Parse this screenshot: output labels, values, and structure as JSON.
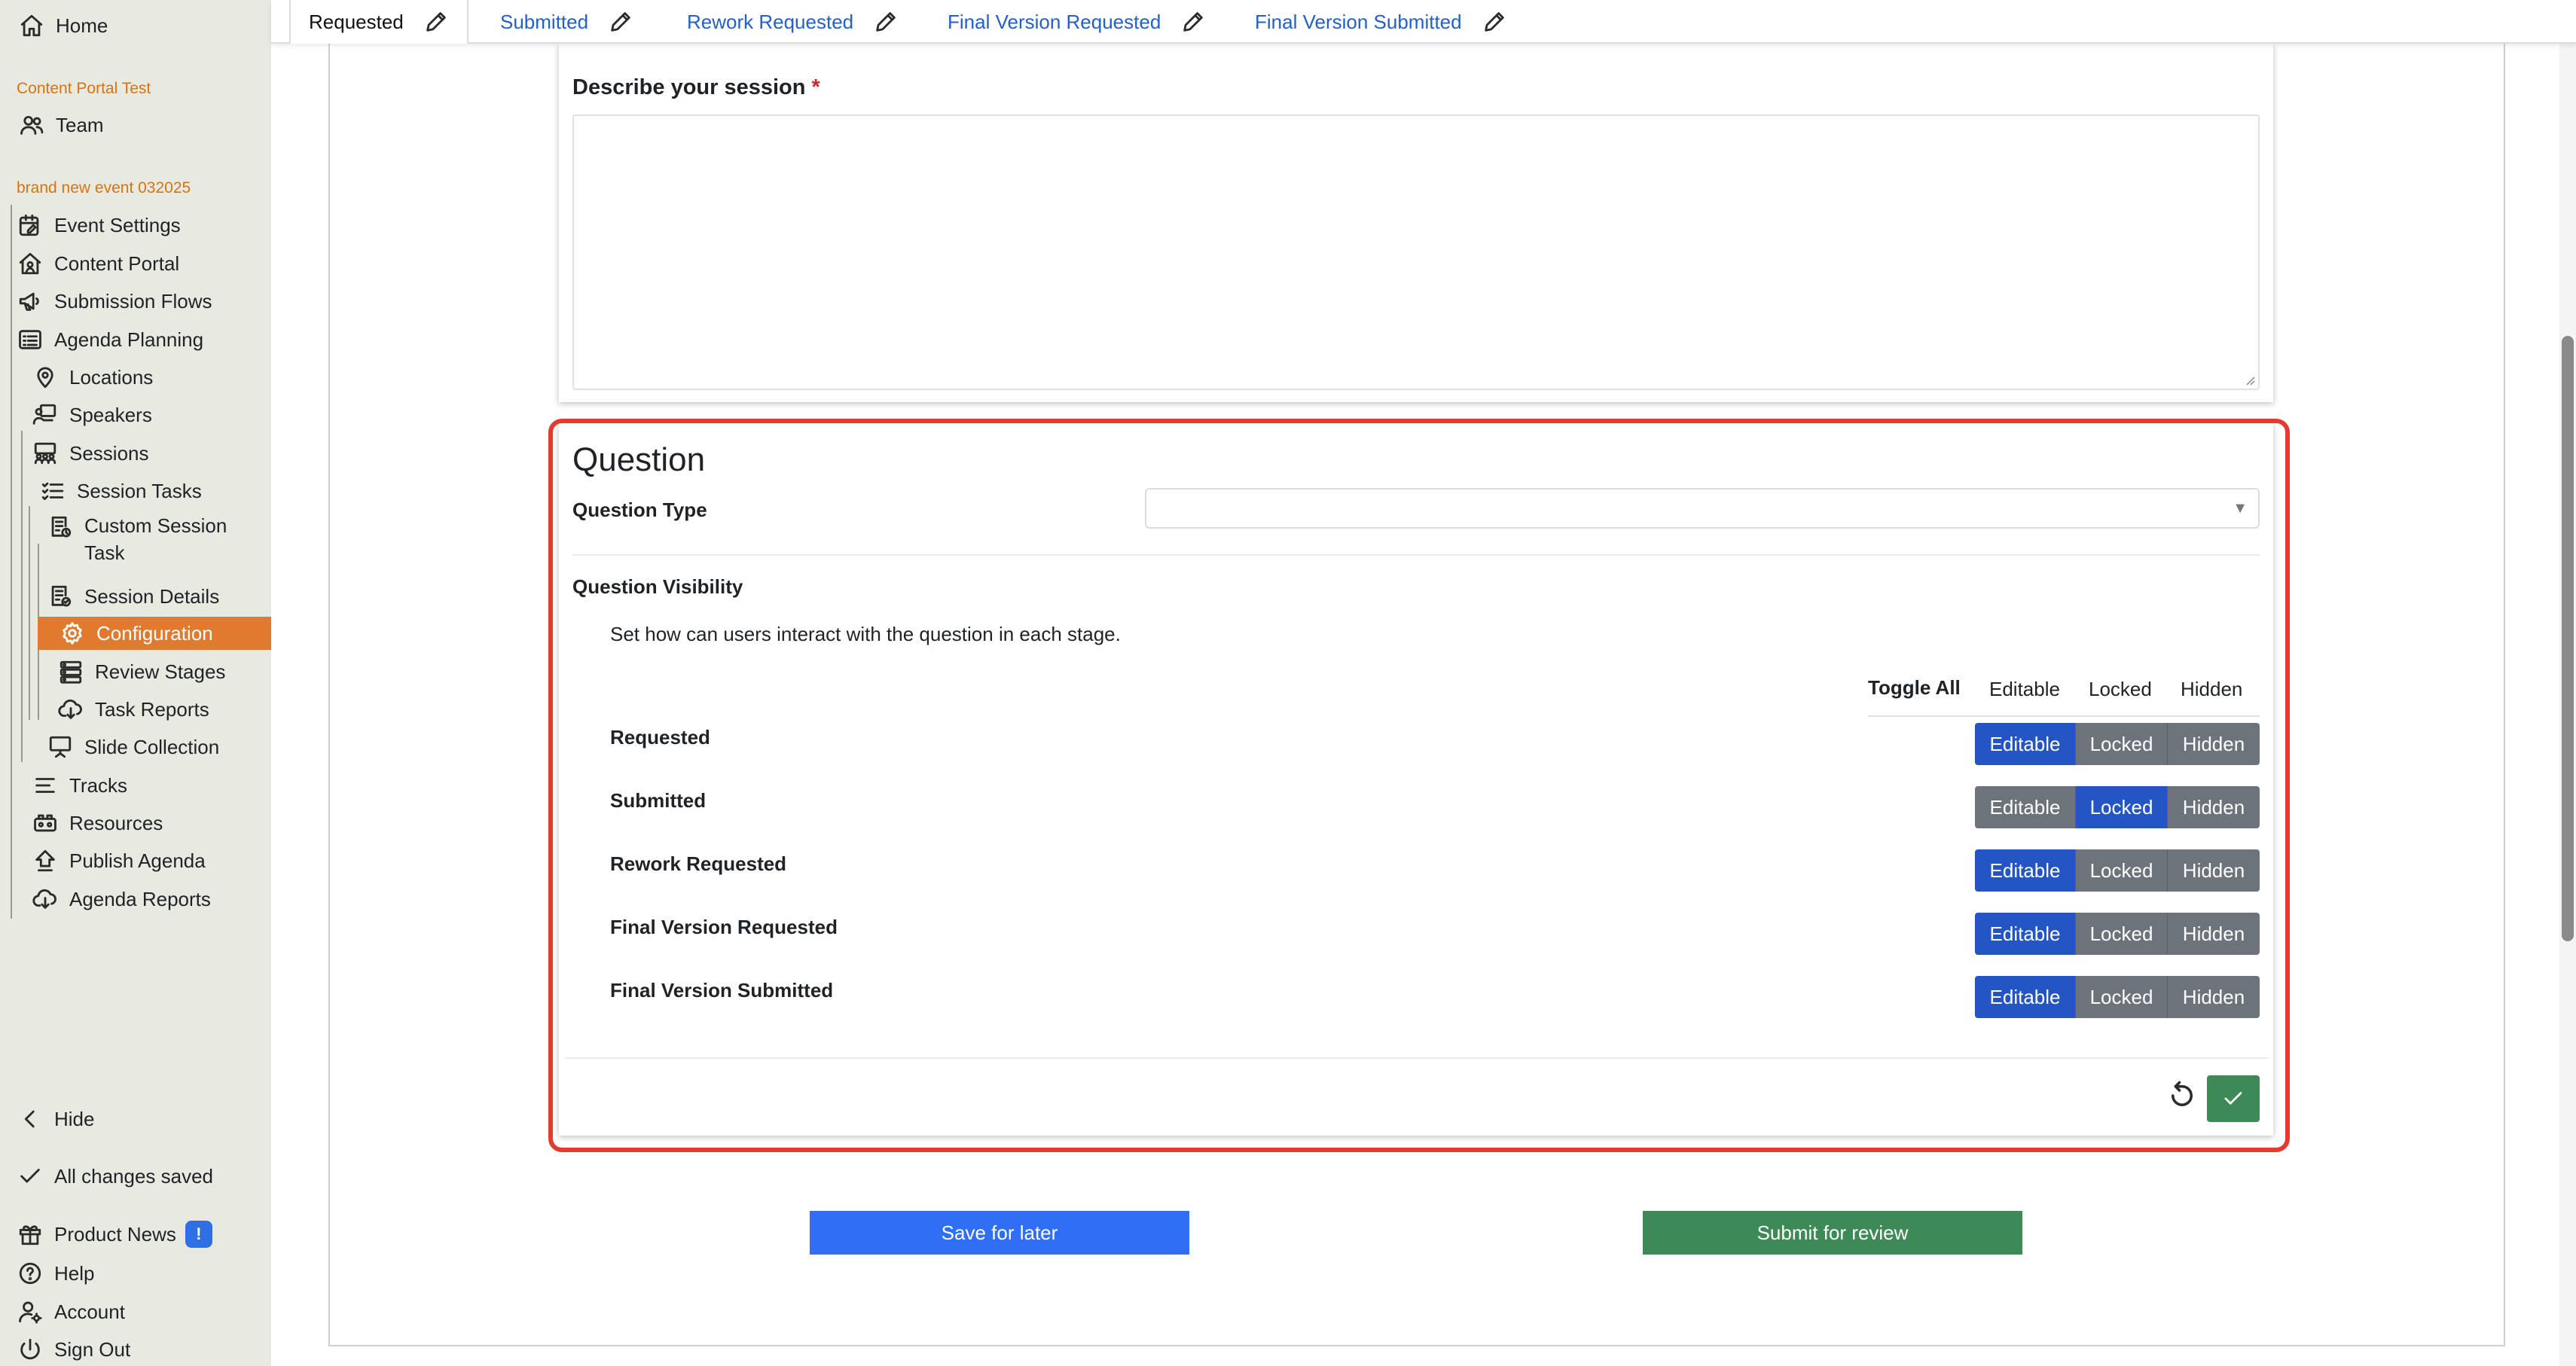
{
  "sidebar": {
    "home": "Home",
    "section_org": "Content Portal Test",
    "team": "Team",
    "section_event": "brand new event 032025",
    "event_settings": "Event Settings",
    "content_portal": "Content Portal",
    "submission_flows": "Submission Flows",
    "agenda_planning": "Agenda Planning",
    "locations": "Locations",
    "speakers": "Speakers",
    "sessions": "Sessions",
    "session_tasks": "Session Tasks",
    "custom_session_task_1": "Custom Session",
    "custom_session_task_2": "Task",
    "session_details": "Session Details",
    "configuration": "Configuration",
    "review_stages": "Review Stages",
    "task_reports": "Task Reports",
    "slide_collection": "Slide Collection",
    "tracks": "Tracks",
    "resources": "Resources",
    "publish_agenda": "Publish Agenda",
    "agenda_reports": "Agenda Reports",
    "hide": "Hide",
    "changes_saved": "All changes saved",
    "product_news": "Product News",
    "product_news_badge": "!",
    "help": "Help",
    "account": "Account",
    "sign_out": "Sign Out",
    "active_color": "#e07a2e"
  },
  "tabs": [
    {
      "label": "Requested",
      "active": true
    },
    {
      "label": "Submitted",
      "active": false
    },
    {
      "label": "Rework Requested",
      "active": false
    },
    {
      "label": "Final Version Requested",
      "active": false
    },
    {
      "label": "Final Version Submitted",
      "active": false
    }
  ],
  "describe": {
    "label": "Describe your session",
    "required_mark": "*",
    "value": ""
  },
  "question": {
    "title": "Question",
    "type_label": "Question Type",
    "type_value": "",
    "visibility_label": "Question Visibility",
    "helper": "Set how can users interact with the question in each stage.",
    "toggle_all": "Toggle All",
    "col_editable": "Editable",
    "col_locked": "Locked",
    "col_hidden": "Hidden",
    "stages": [
      {
        "label": "Requested",
        "selected": "Editable"
      },
      {
        "label": "Submitted",
        "selected": "Locked"
      },
      {
        "label": "Rework Requested",
        "selected": "Editable"
      },
      {
        "label": "Final Version Requested",
        "selected": "Editable"
      },
      {
        "label": "Final Version Submitted",
        "selected": "Editable"
      }
    ],
    "highlight_color": "#e53b2f"
  },
  "actions": {
    "save_later": "Save for later",
    "submit_review": "Submit for review",
    "save_color": "#2f6ff5",
    "submit_color": "#3d8a57"
  }
}
